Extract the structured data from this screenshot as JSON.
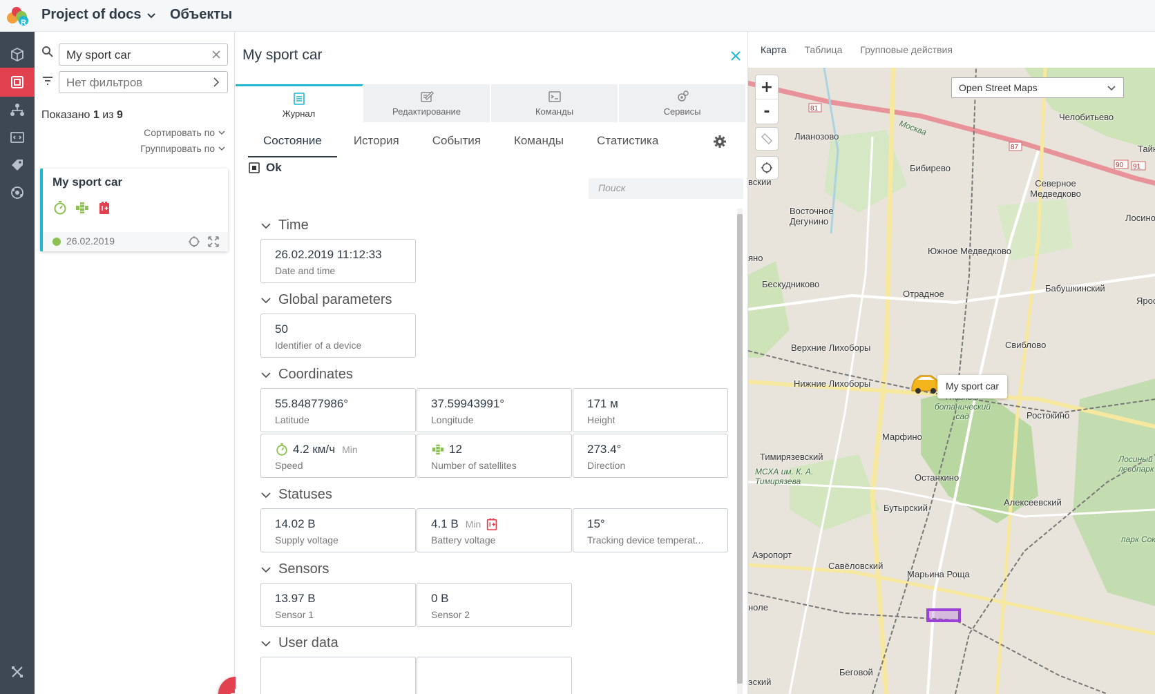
{
  "app": {
    "project": "Project of docs",
    "section": "Объекты",
    "brand_colors": {
      "accent": "#e2424f",
      "teal": "#1fb7d4",
      "sidebar": "#3d4852"
    }
  },
  "sidebar": {
    "items": [
      {
        "icon": "cube-icon",
        "active": false
      },
      {
        "icon": "objects-icon",
        "active": true
      },
      {
        "icon": "hierarchy-icon",
        "active": false
      },
      {
        "icon": "code-icon",
        "active": false
      },
      {
        "icon": "tag-icon",
        "active": false
      },
      {
        "icon": "network-icon",
        "active": false
      },
      {
        "icon": "tools-icon",
        "active": false
      }
    ]
  },
  "list": {
    "search_value": "My sport car",
    "filter_placeholder": "Нет фильтров",
    "shown_prefix": "Показано",
    "shown_count": "1",
    "shown_of": "из",
    "shown_total": "9",
    "sort_label": "Сортировать по",
    "group_label": "Группировать по",
    "card": {
      "title": "My sport car",
      "date": "26.02.2019",
      "status_color": "#8cc152",
      "icons": [
        "speed-icon",
        "satellite-icon",
        "battery-icon"
      ]
    }
  },
  "detail": {
    "title": "My sport car",
    "tabs": [
      {
        "label": "Журнал",
        "icon": "journal-icon",
        "active": true
      },
      {
        "label": "Редактирование",
        "icon": "edit-icon",
        "active": false
      },
      {
        "label": "Команды",
        "icon": "terminal-icon",
        "active": false
      },
      {
        "label": "Сервисы",
        "icon": "services-icon",
        "active": false
      }
    ],
    "subtabs": [
      "Состояние",
      "История",
      "События",
      "Команды",
      "Статистика"
    ],
    "status": "Ok",
    "search_placeholder": "Поиск",
    "sections": {
      "time": {
        "title": "Time",
        "items": [
          {
            "value": "26.02.2019 11:12:33",
            "label": "Date and time"
          }
        ]
      },
      "global": {
        "title": "Global parameters",
        "items": [
          {
            "value": "50",
            "label": "Identifier of a device"
          }
        ]
      },
      "coords": {
        "title": "Coordinates",
        "items": [
          {
            "value": "55.84877986°",
            "label": "Latitude"
          },
          {
            "value": "37.59943991°",
            "label": "Longitude"
          },
          {
            "value": "171 м",
            "label": "Height"
          },
          {
            "value": "4.2 км/ч",
            "min": "Min",
            "label": "Speed"
          },
          {
            "value": "12",
            "label": "Number of satellites"
          },
          {
            "value": "273.4°",
            "label": "Direction"
          }
        ]
      },
      "statuses": {
        "title": "Statuses",
        "items": [
          {
            "value": "14.02 В",
            "label": "Supply voltage"
          },
          {
            "value": "4.1 В",
            "min": "Min",
            "label": "Battery voltage"
          },
          {
            "value": "15°",
            "label": "Tracking device temperat..."
          }
        ]
      },
      "sensors": {
        "title": "Sensors",
        "items": [
          {
            "value": "13.97 В",
            "label": "Sensor 1"
          },
          {
            "value": "0 В",
            "label": "Sensor 2"
          }
        ]
      },
      "user": {
        "title": "User data"
      }
    }
  },
  "map": {
    "tabs": [
      "Карта",
      "Таблица",
      "Групповые действия"
    ],
    "layer": "Open Street Maps",
    "zoom_in": "+",
    "zoom_out": "-",
    "car_label": "My sport car",
    "places": [
      "Лианозово",
      "Бибирево",
      "Челобитьево",
      "Северное Медведково",
      "Восточное Дегунино",
      "Южное Медведково",
      "Бескудниково",
      "Отрадное",
      "Бабушкинский",
      "Верхние Лихоборы",
      "Свиблово",
      "Нижние Лихоборы",
      "Марфино",
      "Ростокино",
      "Тимирязевский",
      "Останкино",
      "Алексеевский",
      "Бутырский",
      "Аэропорт",
      "Савёловский",
      "Марьина Роща",
      "Беговой",
      "Лосино",
      "Тайн",
      "Яросл",
      "вский",
      "яно",
      "ноле",
      "эский"
    ],
    "italic_places": [
      "Главный ботанический сад",
      "МСХА им. К. А. Тимирязева",
      "Лосиный лесопарк",
      "парк Сокольники",
      "Москва"
    ],
    "road_numbers": [
      "81",
      "87",
      "90",
      "91"
    ]
  }
}
